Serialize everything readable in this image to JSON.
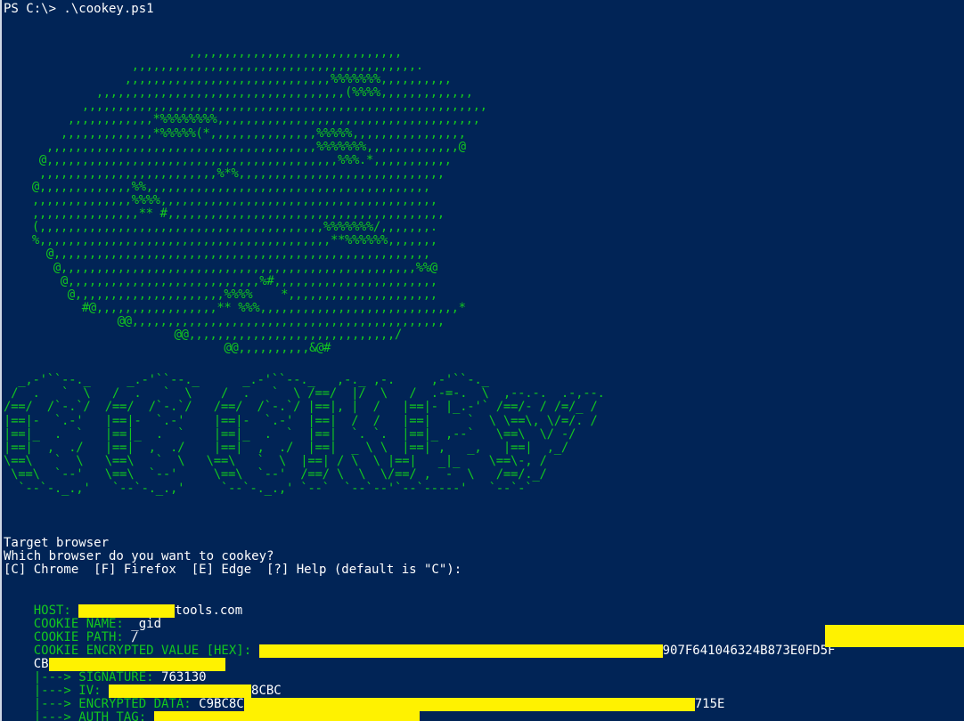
{
  "prompt": "PS C:\\> .\\cookey.ps1",
  "art": {
    "bean": "                          ,,,,,,,,,,,,,,,,,,,,,,,,,,,,,,\n                  ,,,,,,,,,,,,,,,,,,,,,,,,,,,,,,,,,,,,,,,,.\n                 ,,,,,,,,,,,,,,,,,,,,,,,,,,,,,%%%%%%%,,,,,,,,,,\n             ,,,,,,,,,,,,,,,,,,,,,,,,,,,,,,,,,,,(%%%%,,,,,,,,,,,,,\n           ,,,,,,,,,,,,,,,,,,,,,,,,,,,,,,,,,,,,,,,,,,,,,,,,,,,,,,,,,\n         ,,,,,,,,,,,,*%%%%%%%%,,,,,,,,,,,,,,,,,,,,,,,,,,,,,,,,,,,,,\n        ,,,,,,,,,,,,,*%%%%%(*,,,,,,,,,,,,,,,%%%%%,,,,,,,,,,,,,,,,\n      ,,,,,,,,,,,,,,,,,,,,,,,,,,,,,,,,,,,,,,%%%%%%%,,,,,,,,,,,,,@\n     @,,,,,,,,,,,,,,,,,,,,,,,,,,,,,,,,,,,,,,,,,%%%.*,,,,,,,,,,,\n     ,,,,,,,,,,,,,,,,,,,,,,,,,%*%,,,,,,,,,,,,,,,,,,,,,,,,,,,,,\n    @,,,,,,,,,,,,,%%,,,,,,,,,,,,,,,,,,,,,,,,,,,,,,,,,,,,,,,,\n    ,,,,,,,,,,,,,,%%%%,,,,,,,,,,,,,,,,,,,,,,,,,,,,,,,,,,,,,,,\n    ,,,,,,,,,,,,,,,** #,,,,,,,,,,,,,,,,,,,,,,,,,,,,,,,,,,,,,,,\n    (,,,,,,,,,,,,,,,,,,,,,,,,,,,,,,,,,,,,,,,,%%%%%%%/,,,,,,,.\n    %,,,,,,,,,,,,,,,,,,,,,,,,,,,,,,,,,,,,,,,,,**%%%%%%,,,,,,,\n      @,,,,,,,,,,,,,,,,,,,,,,,,,,,,,,,,,,,,,,,,,,,,,,,,,,,,,\n       @,,,,,,,,,,,,,,,,,,,,,,,,,,,,,,,,,,,,,,,,,,,,,,,,,,%%@\n        @,,,,,,,,,,,,,,,,,,,,,,,,,,,%#,,,,,,,,,,,,,,,,,,,,,,,\n         @,,,,,,,,,,,,,,,,,,,,,%%%%    *,,,,,,,,,,,,,,,,,,,,,\n           #@,,,,,,,,,,,,,,,,,** %%%,,,,,,,,,,,,,,,,,,,,,,,,,,,,*\n                @@,,,,,,,,,,,,,,,,,,,,,,,,,,,,,,,,,,,,,,,,,,,,\n                        @@,,,,,,,,,,,,,,,,,,,,,,,,,,,,,/\n                               @@,,,,,,,,,,&@#",
    "title": "  _,-'``--._     _.-'``--._      _.-'``--._   ,-._ ,-.     ,-'``-._\n /  .   `  \\   /  .   `  \\    /  .   `  \\ /==/  |/  \\   /  .-=-.  \\  ,--.-.  .-,--.\n/==/  /`-.`/  /==/  /`-.`/   /==/  /`-.`/ |==|, |  /   |==|- |_.-'` /==/- / /=/_ /\n|==|-  `.-'   |==|-  `.-'    |==|-  `.-'  |==|  /  /   |==|     `  \\ \\==\\, \\/=/. /\n|==|_  .  `   |==|_  .  `    |==|_  .  `  |==|  `. `.  |==|_ ,--`   \\==\\  \\/ -/\n|==|  ,  ./   |==|  ,  ./    |==|  ,  ./  |==|  _ \\ \\  |==| ,   _,   |==|  ,_/\n\\==\\   `  \\   \\==\\   `  \\   \\==\\   `  \\  |==| / \\  \\ |==|   _|_    \\==\\-, /\n \\==\\  `--'   \\==\\  `--'     \\==\\  `--'  /==/ \\  \\  \\/==/ ,  -  \\   /==/._/\n  `--`-._.,'   `--`-._.,'     `--`-._.,' `--`  `--`--'`--`-----'   `--`-`"
  },
  "prompt_block": {
    "heading": "Target browser",
    "question": "Which browser do you want to cookey?",
    "options": "[C] Chrome  [F] Firefox  [E] Edge  [?] Help (default is \"C\"):"
  },
  "output": {
    "host_label": "HOST: ",
    "host_value_suffix": "tools.com",
    "name_label": "COOKIE NAME: ",
    "name_value": "_gid",
    "path_label": "COOKIE PATH: ",
    "path_value": "/",
    "encrypted_label": "COOKIE ENCRYPTED VALUE [HEX]: ",
    "encrypted_visible": "907F641046324B873E0FD5F",
    "encrypted_wrap_prefix": "CB",
    "signature_label": "|---> SIGNATURE: ",
    "signature_value": "763130",
    "iv_label": "|---> IV: ",
    "iv_visible": "8CBC",
    "data_label": "|---> ENCRYPTED DATA: ",
    "data_prefix": "C9BC8C",
    "data_suffix": "715E",
    "tag_label": "|---> AUTH TAG: "
  },
  "colors": {
    "background": "#012456",
    "text": "#ffffff",
    "art": "#13c71f",
    "redaction": "#fff200"
  }
}
